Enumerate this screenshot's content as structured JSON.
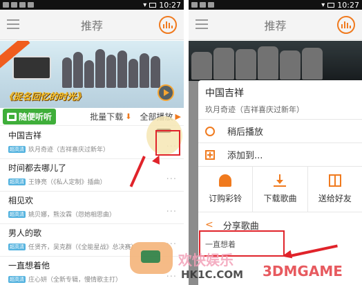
{
  "status_time": "10:27",
  "left": {
    "title": "推荐",
    "banner_caption": "《捉名回忆的时光》",
    "toolbar": {
      "random_label": "随便听听",
      "batch_download": "批量下载",
      "play_all": "全部播放"
    },
    "songs": [
      {
        "title": "中国吉祥",
        "badge": "超高清",
        "meta": "玖月奇迹（吉祥喜庆过新年）"
      },
      {
        "title": "时间都去哪儿了",
        "badge": "超高清",
        "meta": "王铮亮（《私人定制》插曲）"
      },
      {
        "title": "相见欢",
        "badge": "超高清",
        "meta": "姚贝娜，熊汝霖（怨她相思曲）"
      },
      {
        "title": "男人的歌",
        "badge": "超高清",
        "meta": "任贤齐，吴克群（《全能星战》总决赛）"
      },
      {
        "title": "一直想着他",
        "badge": "超高清",
        "meta": "庄心妍（全新专辑，慢情歌主打）"
      }
    ],
    "more_glyph": "···"
  },
  "right": {
    "title": "推荐",
    "sheet": {
      "song_title": "中国吉祥",
      "song_sub": "玖月奇迹（吉祥喜庆过新年）",
      "options": [
        {
          "label": "稍后播放",
          "icon": "clock-icon"
        },
        {
          "label": "添加到...",
          "icon": "add-icon"
        }
      ],
      "grid": [
        {
          "label": "订购彩铃",
          "icon": "bell-icon"
        },
        {
          "label": "下载歌曲",
          "icon": "download-icon"
        },
        {
          "label": "送给好友",
          "icon": "gift-icon"
        }
      ],
      "share_label": "分享歌曲",
      "partial_next": "一直想着"
    }
  },
  "watermark": {
    "text": "欢快娱乐",
    "site": "HK1C.COM",
    "brand": "3DMGAME"
  },
  "colors": {
    "accent": "#f07a1e",
    "highlight": "#e0232a",
    "green": "#3fae3a"
  }
}
